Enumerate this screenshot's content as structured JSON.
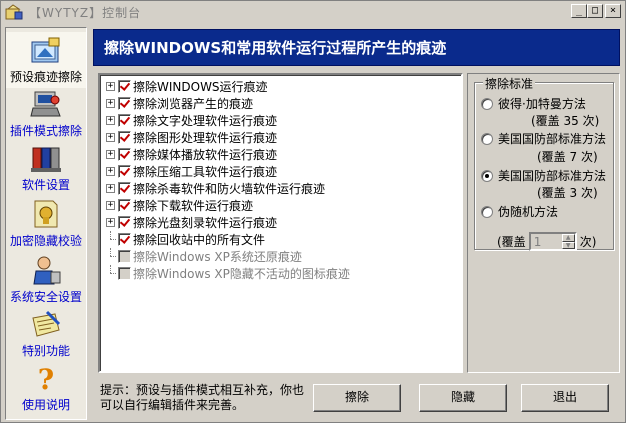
{
  "window": {
    "title": "【WYTYZ】控制台",
    "min": "_",
    "max": "□",
    "close": "×"
  },
  "nav": [
    {
      "label": "预设痕迹擦除",
      "icon": "preset-erase-icon",
      "active": true
    },
    {
      "label": "插件模式擦除",
      "icon": "plugin-erase-icon",
      "active": false
    },
    {
      "label": "软件设置",
      "icon": "software-settings-icon",
      "active": false
    },
    {
      "label": "加密隐藏校验",
      "icon": "encrypt-hide-icon",
      "active": false
    },
    {
      "label": "系统安全设置",
      "icon": "system-security-icon",
      "active": false
    },
    {
      "label": "特别功能",
      "icon": "special-function-icon",
      "active": false
    },
    {
      "label": "使用说明",
      "icon": "help-question-icon",
      "active": false
    }
  ],
  "banner": {
    "title": "擦除WINDOWS和常用软件运行过程所产生的痕迹"
  },
  "tree": [
    {
      "label": "擦除WINDOWS运行痕迹",
      "expandable": true,
      "checked": true,
      "disabled": false
    },
    {
      "label": "擦除浏览器产生的痕迹",
      "expandable": true,
      "checked": true,
      "disabled": false
    },
    {
      "label": "擦除文字处理软件运行痕迹",
      "expandable": true,
      "checked": true,
      "disabled": false
    },
    {
      "label": "擦除图形处理软件运行痕迹",
      "expandable": true,
      "checked": true,
      "disabled": false
    },
    {
      "label": "擦除媒体播放软件运行痕迹",
      "expandable": true,
      "checked": true,
      "disabled": false
    },
    {
      "label": "擦除压缩工具软件运行痕迹",
      "expandable": true,
      "checked": true,
      "disabled": false
    },
    {
      "label": "擦除杀毒软件和防火墙软件运行痕迹",
      "expandable": true,
      "checked": true,
      "disabled": false
    },
    {
      "label": "擦除下载软件运行痕迹",
      "expandable": true,
      "checked": true,
      "disabled": false
    },
    {
      "label": "擦除光盘刻录软件运行痕迹",
      "expandable": true,
      "checked": true,
      "disabled": false
    },
    {
      "label": "擦除回收站中的所有文件",
      "expandable": false,
      "checked": true,
      "disabled": false
    },
    {
      "label": "擦除Windows XP系统还原痕迹",
      "expandable": false,
      "checked": false,
      "disabled": true
    },
    {
      "label": "擦除Windows XP隐藏不活动的图标痕迹",
      "expandable": false,
      "checked": false,
      "disabled": true
    }
  ],
  "standard": {
    "title": "擦除标准",
    "options": [
      {
        "label": "彼得·加特曼方法",
        "sub": "(覆盖 35 次)",
        "selected": false
      },
      {
        "label": "美国国防部标准方法",
        "sub": "(覆盖 7 次)",
        "selected": false
      },
      {
        "label": "美国国防部标准方法",
        "sub": "(覆盖 3 次)",
        "selected": true
      },
      {
        "label": "伪随机方法",
        "sub": "",
        "selected": false
      }
    ],
    "spin_prefix": "(覆盖",
    "spin_value": "1",
    "spin_suffix": "次)"
  },
  "hint": "提示：预设与插件模式相互补充，你也可以自行编辑插件来完善。",
  "buttons": {
    "erase": "擦除",
    "hide": "隐藏",
    "exit": "退出"
  }
}
